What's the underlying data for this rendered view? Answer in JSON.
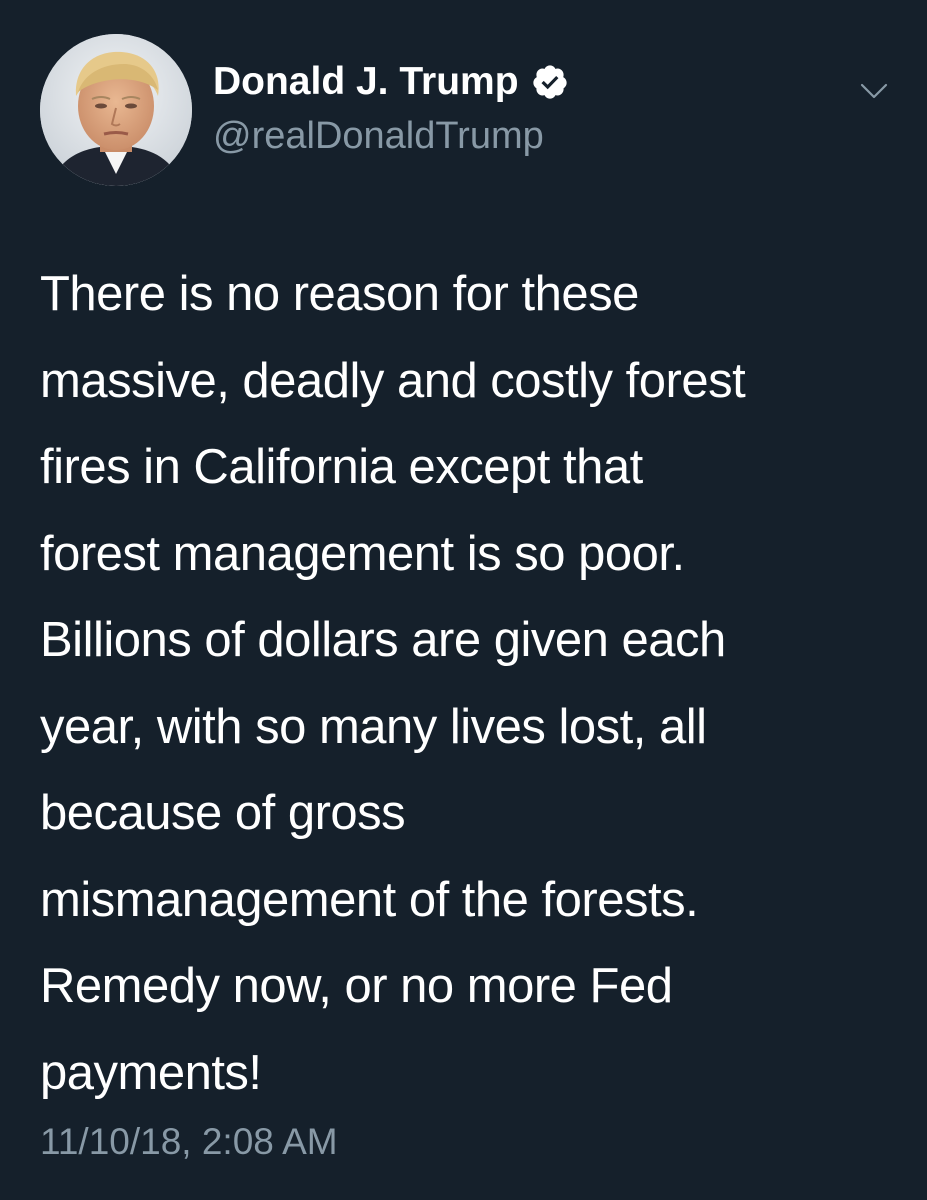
{
  "tweet": {
    "author": {
      "display_name": "Donald J. Trump",
      "handle": "@realDonaldTrump",
      "verified": true,
      "avatar_icon": "profile-photo"
    },
    "menu_icon": "chevron-down-icon",
    "text": "There is no reason for these\nmassive, deadly and costly forest\nfires in California except that\nforest management is so poor.\nBillions of dollars are given each\nyear, with so many lives lost, all\nbecause of gross\nmismanagement of the forests.\nRemedy now, or no more Fed\npayments!",
    "timestamp": "11/10/18, 2:08 AM"
  },
  "colors": {
    "background": "#15202b",
    "primary_text": "#ffffff",
    "secondary_text": "#8899a6",
    "verified_badge": "#ffffff"
  }
}
